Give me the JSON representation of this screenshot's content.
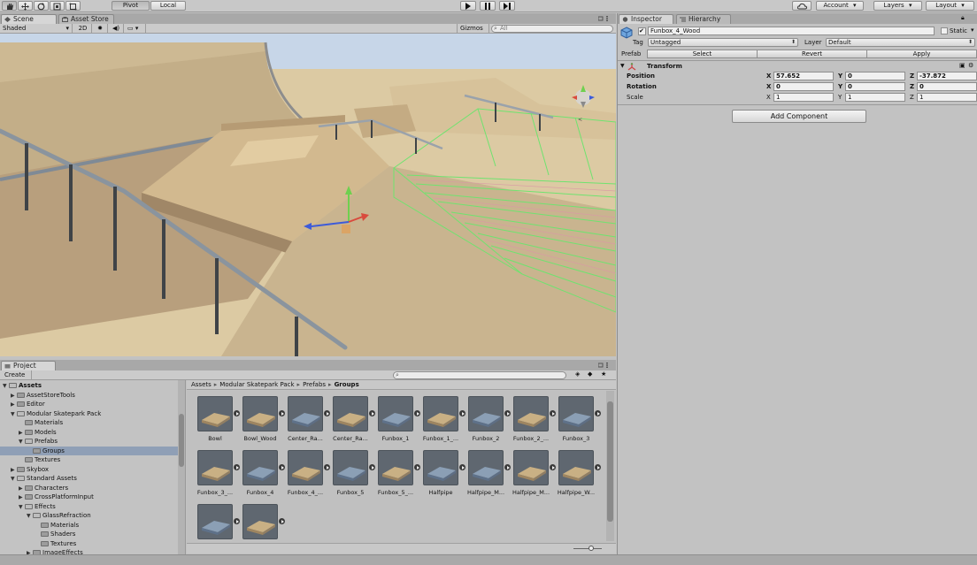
{
  "toolbar": {
    "pivot_label": "Pivot",
    "local_label": "Local",
    "account_label": "Account",
    "layers_label": "Layers",
    "layout_label": "Layout"
  },
  "scene": {
    "tabs": [
      {
        "label": "Scene"
      },
      {
        "label": "Asset Store"
      }
    ],
    "shading_mode": "Shaded",
    "mode_2d": "2D",
    "gizmos_label": "Gizmos",
    "search_placeholder": "All"
  },
  "project": {
    "tab_label": "Project",
    "create_label": "Create",
    "tree": [
      {
        "label": "Assets",
        "depth": 0,
        "expanded": true,
        "bold": true
      },
      {
        "label": "AssetStoreTools",
        "depth": 1,
        "expanded": false
      },
      {
        "label": "Editor",
        "depth": 1,
        "expanded": false
      },
      {
        "label": "Modular Skatepark Pack",
        "depth": 1,
        "expanded": true
      },
      {
        "label": "Materials",
        "depth": 2,
        "leaf": true
      },
      {
        "label": "Models",
        "depth": 2,
        "expanded": false
      },
      {
        "label": "Prefabs",
        "depth": 2,
        "expanded": true
      },
      {
        "label": "Groups",
        "depth": 3,
        "leaf": true,
        "selected": true
      },
      {
        "label": "Textures",
        "depth": 2,
        "leaf": true
      },
      {
        "label": "Skybox",
        "depth": 1,
        "expanded": false
      },
      {
        "label": "Standard Assets",
        "depth": 1,
        "expanded": true
      },
      {
        "label": "Characters",
        "depth": 2,
        "expanded": false
      },
      {
        "label": "CrossPlatformInput",
        "depth": 2,
        "expanded": false
      },
      {
        "label": "Effects",
        "depth": 2,
        "expanded": true
      },
      {
        "label": "GlassRefraction",
        "depth": 3,
        "expanded": true
      },
      {
        "label": "Materials",
        "depth": 4,
        "leaf": true
      },
      {
        "label": "Shaders",
        "depth": 4,
        "leaf": true
      },
      {
        "label": "Textures",
        "depth": 4,
        "leaf": true
      },
      {
        "label": "ImageEffects",
        "depth": 3,
        "expanded": false
      }
    ],
    "breadcrumb": [
      "Assets",
      "Modular Skatepark Pack",
      "Prefabs",
      "Groups"
    ],
    "assets": [
      {
        "label": "Bowl",
        "thumb": "wood"
      },
      {
        "label": "Bowl_Wood",
        "thumb": "wood"
      },
      {
        "label": "Center_Ra...",
        "thumb": "steel"
      },
      {
        "label": "Center_Ra...",
        "thumb": "wood"
      },
      {
        "label": "Funbox_1",
        "thumb": "steel"
      },
      {
        "label": "Funbox_1_...",
        "thumb": "wood"
      },
      {
        "label": "Funbox_2",
        "thumb": "steel"
      },
      {
        "label": "Funbox_2_...",
        "thumb": "wood"
      },
      {
        "label": "Funbox_3",
        "thumb": "steel"
      },
      {
        "label": "Funbox_3_...",
        "thumb": "wood"
      },
      {
        "label": "Funbox_4",
        "thumb": "steel"
      },
      {
        "label": "Funbox_4_...",
        "thumb": "wood"
      },
      {
        "label": "Funbox_5",
        "thumb": "steel"
      },
      {
        "label": "Funbox_5_...",
        "thumb": "wood"
      },
      {
        "label": "Halfpipe",
        "thumb": "steel"
      },
      {
        "label": "Halfpipe_M...",
        "thumb": "steel"
      },
      {
        "label": "Halfpipe_M...",
        "thumb": "wood"
      },
      {
        "label": "Halfpipe_W...",
        "thumb": "wood"
      },
      {
        "label": "",
        "thumb": "steel"
      },
      {
        "label": "",
        "thumb": "wood"
      }
    ]
  },
  "inspector": {
    "tabs": [
      {
        "label": "Inspector"
      },
      {
        "label": "Hierarchy"
      }
    ],
    "object_name": "Funbox_4_Wood",
    "static_label": "Static",
    "tag_label": "Tag",
    "tag_value": "Untagged",
    "layer_label": "Layer",
    "layer_value": "Default",
    "prefab_label": "Prefab",
    "prefab_select": "Select",
    "prefab_revert": "Revert",
    "prefab_apply": "Apply",
    "transform_title": "Transform",
    "position_label": "Position",
    "rotation_label": "Rotation",
    "scale_label": "Scale",
    "axes": {
      "x": "X",
      "y": "Y",
      "z": "Z"
    },
    "position": {
      "x": "57.652",
      "y": "0",
      "z": "-37.872"
    },
    "rotation": {
      "x": "0",
      "y": "0",
      "z": "0"
    },
    "scale": {
      "x": "1",
      "y": "1",
      "z": "1"
    },
    "add_component_label": "Add Component"
  },
  "colors": {
    "accent_selection": "#8f9fb6",
    "panel_bg": "#c2c2c2",
    "wireframe": "#6fe36f",
    "sand": "#d9c9a5"
  },
  "icons": [
    "hand-icon",
    "move-icon",
    "rotate-icon",
    "scale-icon",
    "rect-icon",
    "play-icon",
    "pause-icon",
    "step-icon",
    "cloud-icon",
    "sun-icon",
    "audio-icon",
    "lock-icon",
    "gear-icon"
  ]
}
